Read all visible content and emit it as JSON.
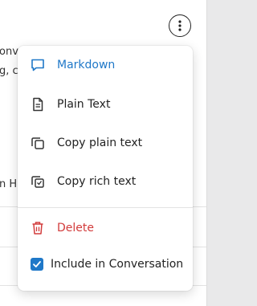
{
  "background": {
    "text_lines": [
      "onv",
      "g, c",
      "n H"
    ]
  },
  "menu": {
    "items": [
      {
        "label": "Markdown",
        "icon": "chat-bubble-icon"
      },
      {
        "label": "Plain Text",
        "icon": "document-icon"
      },
      {
        "label": "Copy plain text",
        "icon": "copy-icon"
      },
      {
        "label": "Copy rich text",
        "icon": "copy-rich-icon"
      },
      {
        "label": "Delete",
        "icon": "trash-icon"
      }
    ],
    "include_checkbox": {
      "label": "Include in Conversation",
      "checked": true
    }
  },
  "colors": {
    "accent": "#1f78c8",
    "danger": "#d23b3b",
    "text": "#222222"
  }
}
